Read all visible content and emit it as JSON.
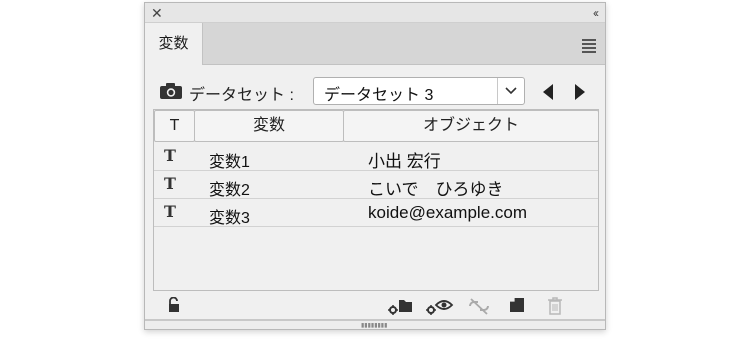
{
  "window": {
    "close_icon": "close-icon",
    "collapse_label": "‹‹"
  },
  "tabs": [
    {
      "label": "変数",
      "active": true
    }
  ],
  "dataset": {
    "label": "データセット :",
    "selected": "データセット 3",
    "camera_icon": "camera-icon"
  },
  "table": {
    "headers": [
      "T",
      "変数",
      "オブジェクト"
    ],
    "rows": [
      {
        "type_icon": "T",
        "name": "変数1",
        "object": "小出 宏行"
      },
      {
        "type_icon": "T",
        "name": "変数2",
        "object": "こいで　ひろゆき"
      },
      {
        "type_icon": "T",
        "name": "変数3",
        "object": "koide@example.com"
      }
    ]
  },
  "footer_icons": [
    "lock-icon",
    "make-dynamic-object-icon",
    "make-dynamic-visibility-icon",
    "unbind-icon",
    "new-variable-icon",
    "delete-icon"
  ],
  "colors": {
    "panel_bg": "#f0f0f0",
    "tabbar_bg": "#d6d6d6",
    "border": "#bdbdbd"
  }
}
